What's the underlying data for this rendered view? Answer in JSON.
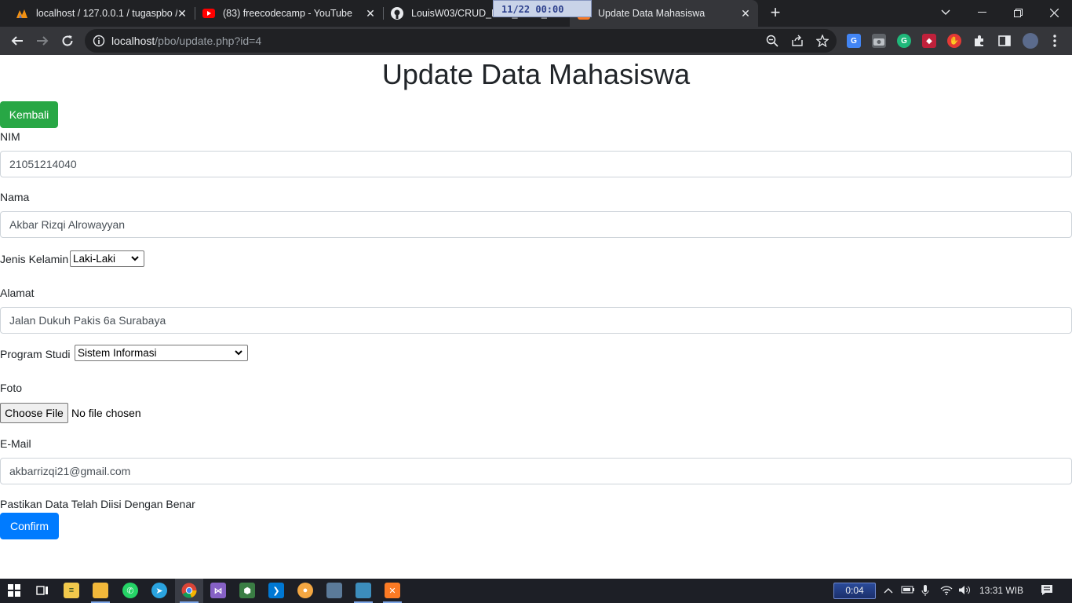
{
  "browser": {
    "tabs": [
      {
        "title": "localhost / 127.0.0.1 / tugaspbo /",
        "icon": "phpmyadmin-icon"
      },
      {
        "title": "(83) freecodecamp - YouTube",
        "icon": "youtube-icon"
      },
      {
        "title": "LouisW03/CRUD_PBO_11/22_C...",
        "icon": "github-icon"
      },
      {
        "title": "Update Data Mahasiswa",
        "icon": "xampp-icon"
      }
    ],
    "overlay_clock": "11/22 00:00",
    "url_host": "localhost",
    "url_path": "/pbo/update.php?id=4"
  },
  "page": {
    "title": "Update Data Mahasiswa",
    "back_button": "Kembali",
    "nim_label": "NIM",
    "nim_value": "21051214040",
    "nama_label": "Nama",
    "nama_value": "Akbar Rizqi Alrowayyan",
    "gender_label": "Jenis Kelamin",
    "gender_value": "Laki-Laki",
    "alamat_label": "Alamat",
    "alamat_value": "Jalan Dukuh Pakis 6a Surabaya",
    "prodi_label": "Program Studi",
    "prodi_value": "Sistem Informasi",
    "foto_label": "Foto",
    "file_button": "Choose File",
    "file_status": "No file chosen",
    "email_label": "E-Mail",
    "email_value": "akbarrizqi21@gmail.com",
    "confirm_note": "Pastikan Data Telah Diisi Dengan Benar",
    "confirm_button": "Confirm"
  },
  "taskbar": {
    "timer": "0:04",
    "clock": "13:31",
    "timezone": "WIB"
  },
  "colors": {
    "success": "#28a745",
    "primary": "#007bff",
    "chrome_dark": "#202124"
  }
}
